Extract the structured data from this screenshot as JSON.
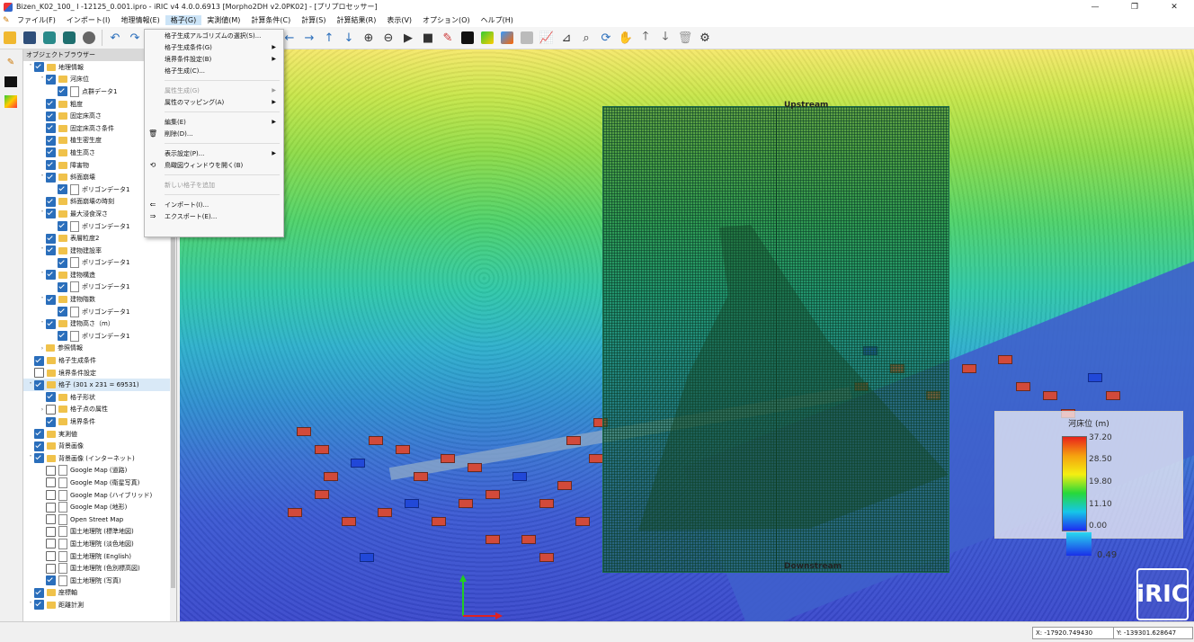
{
  "window": {
    "title": "Bizen_K02_100_ I -12125_0.001.ipro - iRIC v4 4.0.0.6913 [Morpho2DH v2.0PK02] - [プリプロセッサー]",
    "minimize": "—",
    "maximize": "❐",
    "close": "✕"
  },
  "menubar": [
    "ファイル(F)",
    "インポート(I)",
    "地理情報(E)",
    "格子(G)",
    "実測値(M)",
    "計算条件(C)",
    "計算(S)",
    "計算結果(R)",
    "表示(V)",
    "オプション(O)",
    "ヘルプ(H)"
  ],
  "panel": {
    "title": "オブジェクトブラウザー"
  },
  "tree": [
    {
      "indent": 0,
      "arrow": "˅",
      "cb": "on",
      "icon": "folder",
      "label": "地理情報"
    },
    {
      "indent": 1,
      "arrow": "˅",
      "cb": "on",
      "icon": "folder",
      "label": "河床位"
    },
    {
      "indent": 2,
      "arrow": "",
      "cb": "on",
      "icon": "doc",
      "label": "点群データ1"
    },
    {
      "indent": 1,
      "arrow": "",
      "cb": "on",
      "icon": "folder",
      "label": "粗度"
    },
    {
      "indent": 1,
      "arrow": "",
      "cb": "on",
      "icon": "folder",
      "label": "固定床高さ"
    },
    {
      "indent": 1,
      "arrow": "",
      "cb": "on",
      "icon": "folder",
      "label": "固定床高さ条件"
    },
    {
      "indent": 1,
      "arrow": "",
      "cb": "on",
      "icon": "folder",
      "label": "植生密生度"
    },
    {
      "indent": 1,
      "arrow": "",
      "cb": "on",
      "icon": "folder",
      "label": "植生高さ"
    },
    {
      "indent": 1,
      "arrow": "",
      "cb": "on",
      "icon": "folder",
      "label": "障害物"
    },
    {
      "indent": 1,
      "arrow": "˅",
      "cb": "on",
      "icon": "folder",
      "label": "斜面崩壊"
    },
    {
      "indent": 2,
      "arrow": "",
      "cb": "on",
      "icon": "doc",
      "label": "ポリゴンデータ1"
    },
    {
      "indent": 1,
      "arrow": "",
      "cb": "on",
      "icon": "folder",
      "label": "斜面崩壊の時刻"
    },
    {
      "indent": 1,
      "arrow": "˅",
      "cb": "on",
      "icon": "folder",
      "label": "最大浸食深さ"
    },
    {
      "indent": 2,
      "arrow": "",
      "cb": "on",
      "icon": "doc",
      "label": "ポリゴンデータ1"
    },
    {
      "indent": 1,
      "arrow": "",
      "cb": "on",
      "icon": "folder",
      "label": "表層粒度2"
    },
    {
      "indent": 1,
      "arrow": "˅",
      "cb": "on",
      "icon": "folder",
      "label": "建物建設率"
    },
    {
      "indent": 2,
      "arrow": "",
      "cb": "on",
      "icon": "doc",
      "label": "ポリゴンデータ1"
    },
    {
      "indent": 1,
      "arrow": "˅",
      "cb": "on",
      "icon": "folder",
      "label": "建物構造"
    },
    {
      "indent": 2,
      "arrow": "",
      "cb": "on",
      "icon": "doc",
      "label": "ポリゴンデータ1"
    },
    {
      "indent": 1,
      "arrow": "˅",
      "cb": "on",
      "icon": "folder",
      "label": "建物階数"
    },
    {
      "indent": 2,
      "arrow": "",
      "cb": "on",
      "icon": "doc",
      "label": "ポリゴンデータ1"
    },
    {
      "indent": 1,
      "arrow": "˅",
      "cb": "on",
      "icon": "folder",
      "label": "建物高さ（m）"
    },
    {
      "indent": 2,
      "arrow": "",
      "cb": "on",
      "icon": "doc",
      "label": "ポリゴンデータ1"
    },
    {
      "indent": 1,
      "arrow": "›",
      "cb": "",
      "icon": "folder",
      "label": "参照情報"
    },
    {
      "indent": 0,
      "arrow": "",
      "cb": "on",
      "icon": "folder",
      "label": "格子生成条件"
    },
    {
      "indent": 0,
      "arrow": "",
      "cb": "off",
      "icon": "folder",
      "label": "境界条件設定"
    },
    {
      "indent": 0,
      "arrow": "˅",
      "cb": "on",
      "icon": "folder",
      "label": "格子 (301 x 231 = 69531)",
      "sel": true
    },
    {
      "indent": 1,
      "arrow": "",
      "cb": "on",
      "icon": "folder",
      "label": "格子形状"
    },
    {
      "indent": 1,
      "arrow": "›",
      "cb": "off",
      "icon": "folder",
      "label": "格子点の属性"
    },
    {
      "indent": 1,
      "arrow": "",
      "cb": "on",
      "icon": "folder",
      "label": "境界条件"
    },
    {
      "indent": 0,
      "arrow": "",
      "cb": "on",
      "icon": "folder",
      "label": "実測値"
    },
    {
      "indent": 0,
      "arrow": "",
      "cb": "on",
      "icon": "folder",
      "label": "背景画像"
    },
    {
      "indent": 0,
      "arrow": "˅",
      "cb": "on",
      "icon": "folder",
      "label": "背景画像 (インターネット)"
    },
    {
      "indent": 1,
      "arrow": "",
      "cb": "off",
      "icon": "doc",
      "label": "Google Map (道路)"
    },
    {
      "indent": 1,
      "arrow": "",
      "cb": "off",
      "icon": "doc",
      "label": "Google Map (衛星写真)"
    },
    {
      "indent": 1,
      "arrow": "",
      "cb": "off",
      "icon": "doc",
      "label": "Google Map (ハイブリッド)"
    },
    {
      "indent": 1,
      "arrow": "",
      "cb": "off",
      "icon": "doc",
      "label": "Google Map (地形)"
    },
    {
      "indent": 1,
      "arrow": "",
      "cb": "off",
      "icon": "doc",
      "label": "Open Street Map"
    },
    {
      "indent": 1,
      "arrow": "",
      "cb": "off",
      "icon": "doc",
      "label": "国土地理院 (標準地図)"
    },
    {
      "indent": 1,
      "arrow": "",
      "cb": "off",
      "icon": "doc",
      "label": "国土地理院 (淡色地図)"
    },
    {
      "indent": 1,
      "arrow": "",
      "cb": "off",
      "icon": "doc",
      "label": "国土地理院 (English)"
    },
    {
      "indent": 1,
      "arrow": "",
      "cb": "off",
      "icon": "doc",
      "label": "国土地理院 (色別標高図)"
    },
    {
      "indent": 1,
      "arrow": "",
      "cb": "on",
      "icon": "doc",
      "label": "国土地理院 (写真)"
    },
    {
      "indent": 0,
      "arrow": "",
      "cb": "on",
      "icon": "folder",
      "label": "座標軸"
    },
    {
      "indent": 0,
      "arrow": "˅",
      "cb": "on",
      "icon": "folder",
      "label": "距離計測"
    }
  ],
  "grid_menu": [
    {
      "label": "格子生成アルゴリズムの選択(S)...",
      "sub": false,
      "dis": false,
      "icon": ""
    },
    {
      "label": "格子生成条件(G)",
      "sub": true,
      "dis": false,
      "icon": ""
    },
    {
      "label": "境界条件設定(B)",
      "sub": true,
      "dis": false,
      "icon": ""
    },
    {
      "label": "格子生成(C)...",
      "sub": false,
      "dis": false,
      "icon": ""
    },
    {
      "sep": true
    },
    {
      "label": "属性生成(G)",
      "sub": true,
      "dis": true,
      "icon": ""
    },
    {
      "label": "属性のマッピング(A)",
      "sub": true,
      "dis": false,
      "icon": ""
    },
    {
      "sep": true
    },
    {
      "label": "編集(E)",
      "sub": true,
      "dis": false,
      "icon": ""
    },
    {
      "label": "削除(D)...",
      "sub": false,
      "dis": false,
      "icon": "🗑"
    },
    {
      "sep": true
    },
    {
      "label": "表示設定(P)...",
      "sub": true,
      "dis": false,
      "icon": ""
    },
    {
      "label": "鳥瞰図ウィンドウを開く(B)",
      "sub": false,
      "dis": false,
      "icon": "⟲"
    },
    {
      "sep": true
    },
    {
      "label": "新しい格子を追加",
      "sub": false,
      "dis": true,
      "icon": ""
    },
    {
      "sep": true
    },
    {
      "label": "インポート(I)...",
      "sub": false,
      "dis": false,
      "icon": "⇐"
    },
    {
      "label": "エクスポート(E)...",
      "sub": false,
      "dis": false,
      "icon": "⇒"
    }
  ],
  "map": {
    "label_upstream": "Upstream",
    "label_downstream": "Downstream"
  },
  "legend": {
    "title": "河床位 (m)",
    "labels": [
      "37.20",
      "28.50",
      "19.80",
      "11.10",
      "0.00"
    ],
    "second_label": "0.49"
  },
  "logo": "iRIC",
  "status": {
    "x": "X: -17920.749430",
    "y": "Y: -139301.628647"
  },
  "colors": {
    "accent": "#2a6ebb",
    "menu_active": "#cce4f7",
    "grid": "#1a6b4a"
  }
}
